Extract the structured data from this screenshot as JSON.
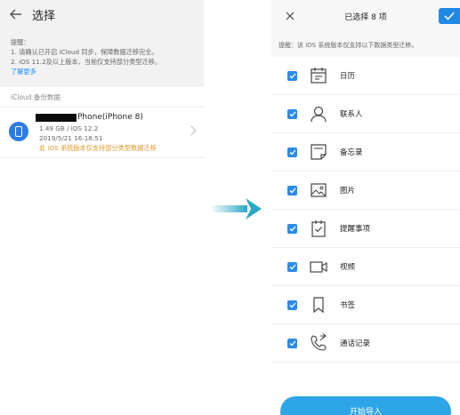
{
  "left": {
    "title": "选择",
    "tips": {
      "heading": "提醒：",
      "line1": "1. 请确认已开启 iCloud 同步，保障数据迁移完全。",
      "line2": "2. iOS 11.2及以上版本，当前仅支持部分类型迁移。",
      "link": "了解更多"
    },
    "section_label": "iCloud 备份数据",
    "backup": {
      "name": "Phone(iPhone 8)",
      "size_os": "1.49 GB / iOS 12.2",
      "datetime": "2019/5/21 16:18:51",
      "warning": "此 iOS 系统版本仅支持部分类型数据迁移"
    }
  },
  "right": {
    "title": "已选择 8 项",
    "tip": "提醒：该 iOS 系统版本仅支持以下数据类型迁移。",
    "items": [
      {
        "label": "日历",
        "icon": "calendar-icon"
      },
      {
        "label": "联系人",
        "icon": "contact-icon"
      },
      {
        "label": "备忘录",
        "icon": "memo-icon"
      },
      {
        "label": "图片",
        "icon": "image-icon"
      },
      {
        "label": "提醒事项",
        "icon": "reminder-icon"
      },
      {
        "label": "视频",
        "icon": "video-icon"
      },
      {
        "label": "书签",
        "icon": "bookmark-icon"
      },
      {
        "label": "通话记录",
        "icon": "call-log-icon"
      }
    ],
    "start_button": "开始导入"
  },
  "colors": {
    "accent": "#2b8be8",
    "button": "#2ea5e6",
    "warning": "#e09a2b",
    "link": "#1a8cff",
    "arrow": "#2aa8c4"
  }
}
